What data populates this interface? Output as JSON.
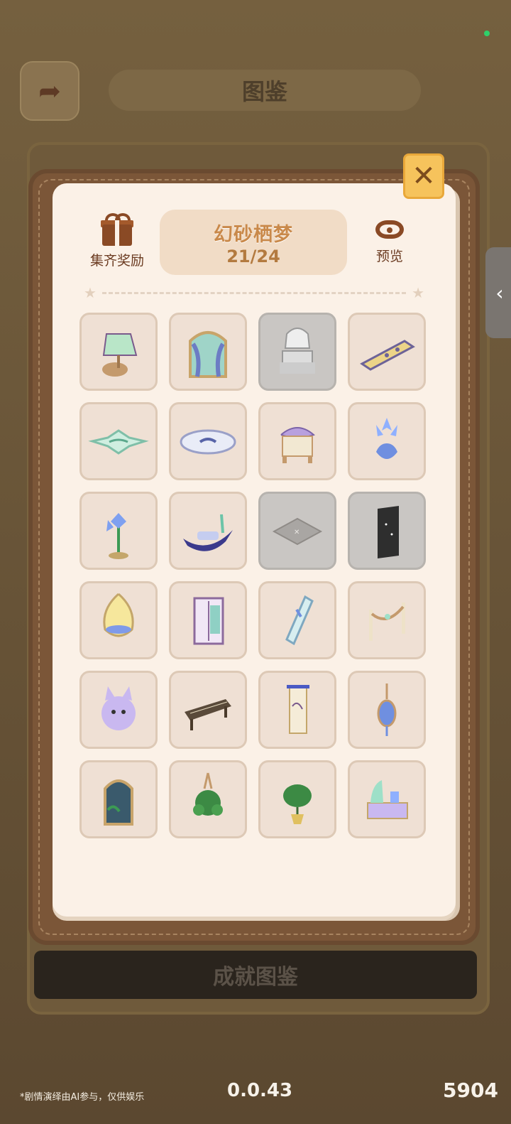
{
  "header": {
    "back_icon": "back-arrow-icon",
    "title": "图鉴"
  },
  "overlay": {
    "close_icon": "close-icon",
    "reward": {
      "icon": "gift-icon",
      "label": "集齐奖励"
    },
    "set": {
      "name": "幻砂栖梦",
      "progress": "21/24"
    },
    "preview": {
      "icon": "eye-icon",
      "label": "预览"
    },
    "items": [
      {
        "name": "lamp",
        "collected": true
      },
      {
        "name": "window-curtain",
        "collected": true
      },
      {
        "name": "canopy-bed",
        "collected": false
      },
      {
        "name": "rug-runner",
        "collected": true
      },
      {
        "name": "lotus-rug",
        "collected": true
      },
      {
        "name": "oval-rug",
        "collected": true
      },
      {
        "name": "purple-stool",
        "collected": true
      },
      {
        "name": "blue-flower-vase",
        "collected": true
      },
      {
        "name": "orchid-plant",
        "collected": true
      },
      {
        "name": "boat-bed",
        "collected": true
      },
      {
        "name": "floor-tile",
        "collected": false
      },
      {
        "name": "wall-panel",
        "collected": false
      },
      {
        "name": "hanging-chair",
        "collected": true
      },
      {
        "name": "wardrobe",
        "collected": true
      },
      {
        "name": "standing-mirror",
        "collected": true
      },
      {
        "name": "rope-barrier",
        "collected": true
      },
      {
        "name": "cat-plush",
        "collected": true
      },
      {
        "name": "guzheng",
        "collected": true
      },
      {
        "name": "scroll-painting",
        "collected": true
      },
      {
        "name": "hanging-ornament",
        "collected": true
      },
      {
        "name": "arched-window",
        "collected": true
      },
      {
        "name": "hanging-plant",
        "collected": true
      },
      {
        "name": "potted-plant",
        "collected": true
      },
      {
        "name": "vanity-desk",
        "collected": true
      }
    ]
  },
  "footer": {
    "achievement_button": "成就图鉴",
    "notice": "*剧情演绎由AI参与，仅供娱乐",
    "version": "0.0.43",
    "score": "5904"
  },
  "colors": {
    "accent": "#c9894a",
    "panel": "#fbf1e7",
    "frame": "#7b5638",
    "close": "#f6c35c"
  }
}
